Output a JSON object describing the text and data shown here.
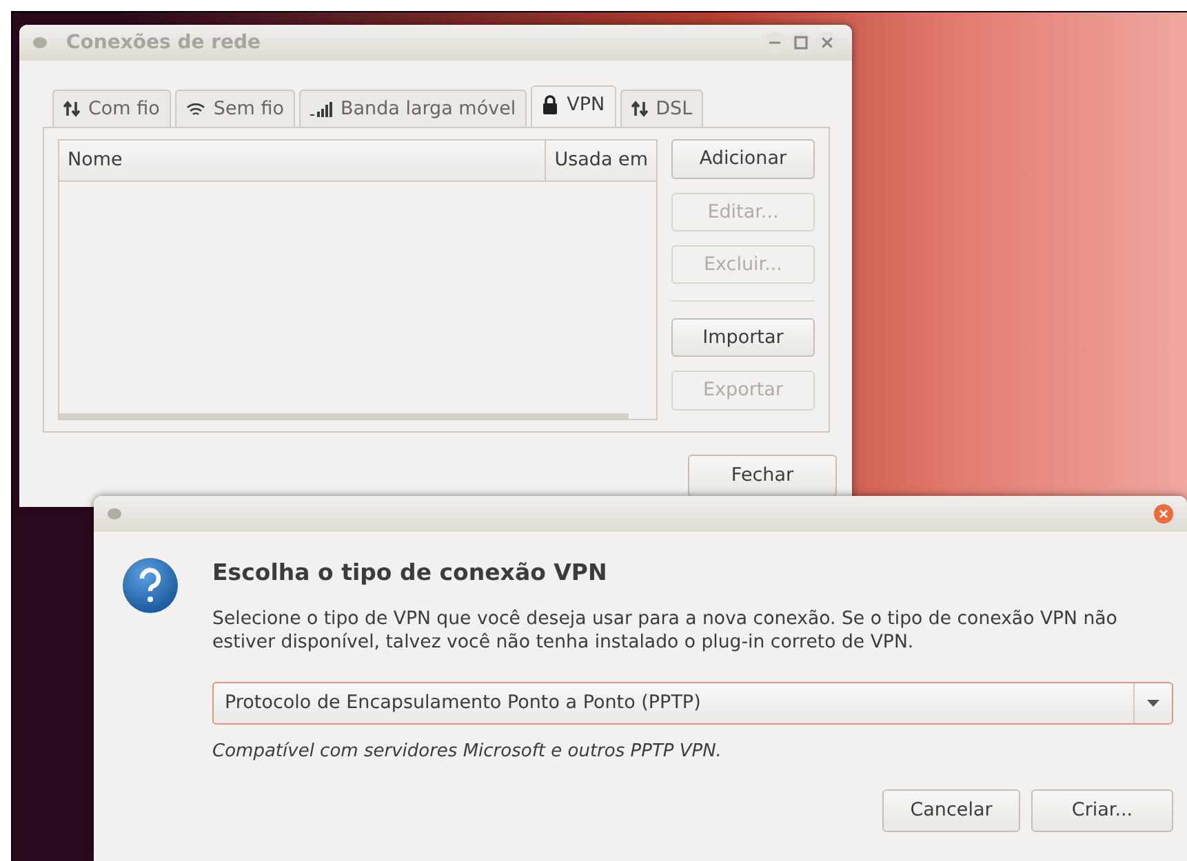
{
  "main_window": {
    "title": "Conexões de rede",
    "tabs": [
      {
        "label": "Com fio",
        "kind": "arrows",
        "selected": false
      },
      {
        "label": "Sem fio",
        "kind": "wifi",
        "selected": false
      },
      {
        "label": "Banda larga móvel",
        "kind": "signal",
        "selected": false
      },
      {
        "label": "VPN",
        "kind": "lock",
        "selected": true
      },
      {
        "label": "DSL",
        "kind": "arrows",
        "selected": false
      }
    ],
    "table": {
      "columns": [
        "Nome",
        "Usada em"
      ]
    },
    "side_buttons": [
      {
        "label": "Adicionar",
        "disabled": false
      },
      {
        "label": "Editar...",
        "disabled": true
      },
      {
        "label": "Excluir...",
        "disabled": true
      },
      {
        "label": "Importar",
        "disabled": false
      },
      {
        "label": "Exportar",
        "disabled": true
      }
    ],
    "close_button": "Fechar"
  },
  "dialog": {
    "heading": "Escolha o tipo de conexão VPN",
    "description": "Selecione o tipo de VPN que você deseja usar para a nova conexão. Se o tipo de conexão VPN não estiver disponível, talvez você não tenha instalado o plug-in correto de VPN.",
    "vpn_type": "Protocolo de Encapsulamento Ponto a Ponto (PPTP)",
    "hint": "Compatível com servidores Microsoft e outros PPTP VPN.",
    "buttons": [
      "Cancelar",
      "Criar..."
    ]
  }
}
